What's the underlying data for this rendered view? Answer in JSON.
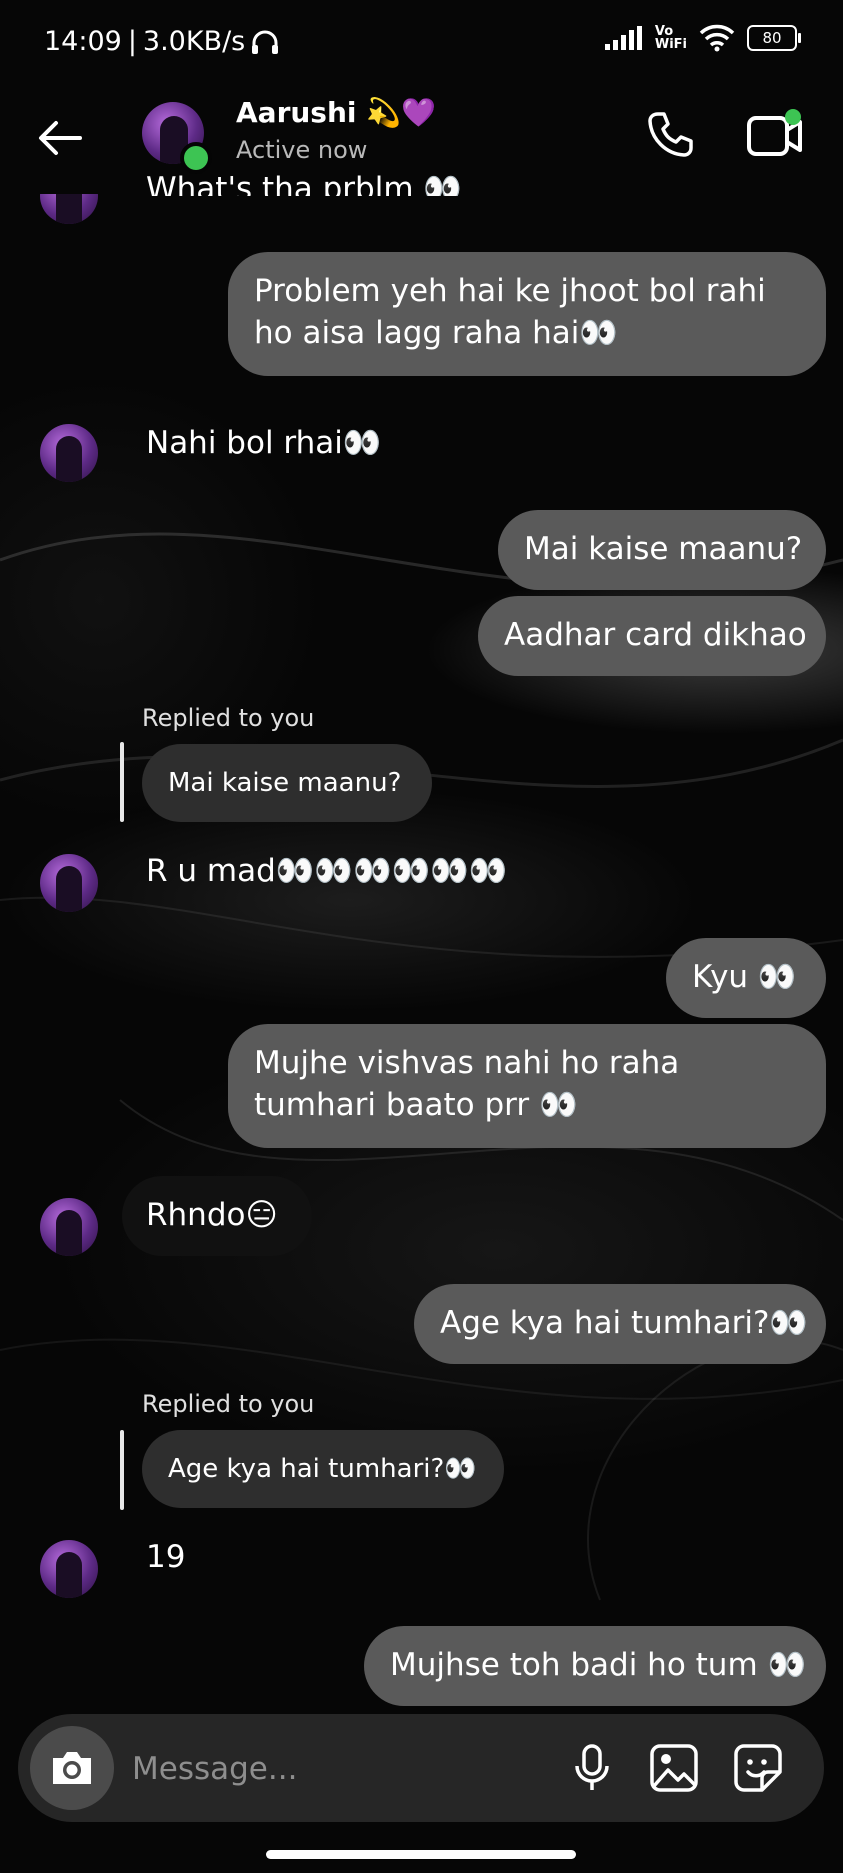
{
  "status_bar": {
    "time": "14:09",
    "speed": "3.0KB/s",
    "network_label": "Vo\nWiFi",
    "battery": "80"
  },
  "header": {
    "name": "Aarushi 💫💜",
    "status": "Active now",
    "online_color": "#3dc453"
  },
  "messages": [
    {
      "from": "them",
      "text": "What's tha prblm 👀"
    },
    {
      "from": "me",
      "text": "Problem yeh hai ke jhoot bol rahi ho aisa lagg raha hai👀"
    },
    {
      "from": "them",
      "text": "Nahi bol rhai👀"
    },
    {
      "from": "me",
      "text": "Mai kaise maanu?"
    },
    {
      "from": "me",
      "text": "Aadhar card dikhao"
    },
    {
      "from": "them",
      "replied_label": "Replied to you",
      "quoted": "Mai kaise maanu?",
      "text": "R u mad👀👀👀👀👀👀"
    },
    {
      "from": "me",
      "text": "Kyu 👀"
    },
    {
      "from": "me",
      "text": "Mujhe vishvas nahi ho raha tumhari baato prr 👀"
    },
    {
      "from": "them",
      "text": "Rhndo😑"
    },
    {
      "from": "me",
      "text": "Age kya hai tumhari?👀"
    },
    {
      "from": "them",
      "replied_label": "Replied to you",
      "quoted": "Age kya hai tumhari?👀",
      "text": "19"
    },
    {
      "from": "me",
      "text": "Mujhse toh badi ho tum 👀"
    }
  ],
  "composer": {
    "placeholder": "Message..."
  },
  "colors": {
    "outgoing_bubble": "#5a5a5a",
    "quoted_bubble": "#2e2e2e",
    "composer": "#262626"
  }
}
